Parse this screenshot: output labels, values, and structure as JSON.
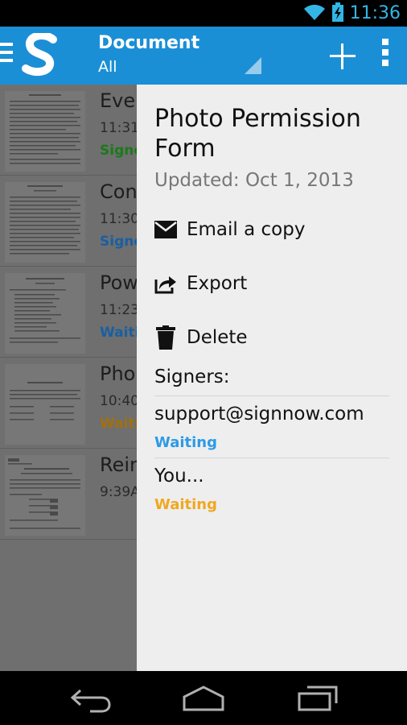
{
  "status_bar": {
    "time": "11:36",
    "icons": [
      "wifi-icon",
      "battery-charging-icon"
    ],
    "time_color": "#33b5e5"
  },
  "action_bar": {
    "title": "Document",
    "subtitle": "All",
    "background": "#1b8fd6",
    "icons": [
      "menu-icon",
      "signnow-logo",
      "add-icon",
      "overflow-menu-icon"
    ]
  },
  "documents": [
    {
      "name": "Even",
      "time": "11:31",
      "status": "Signe",
      "status_color": "#1a7a1a"
    },
    {
      "name": "Con",
      "time": "11:30",
      "status": "Signe",
      "status_color": "#1a5fa0"
    },
    {
      "name": "Pow",
      "time": "11:23",
      "status": "Waitin",
      "status_color": "#1a5fa0"
    },
    {
      "name": "Pho",
      "time": "10:40",
      "status": "Waitin",
      "status_color": "#a07010"
    },
    {
      "name": "Rein",
      "time": "9:39A",
      "status": "",
      "status_color": "#333333"
    }
  ],
  "details": {
    "title": "Photo Permission Form",
    "updated": "Updated: Oct 1, 2013",
    "actions": [
      {
        "label": "Email a copy",
        "icon": "email-icon"
      },
      {
        "label": "Export",
        "icon": "export-icon"
      },
      {
        "label": "Delete",
        "icon": "trash-icon"
      }
    ],
    "signers_label": "Signers:",
    "signers": [
      {
        "name": "support@signnow.com",
        "status": "Waiting",
        "status_color": "#2b9be6"
      },
      {
        "name": "You...",
        "status": "Waiting",
        "status_color": "#f0a820"
      }
    ]
  },
  "nav_bar": {
    "buttons": [
      "back-icon",
      "home-icon",
      "recent-apps-icon"
    ]
  }
}
